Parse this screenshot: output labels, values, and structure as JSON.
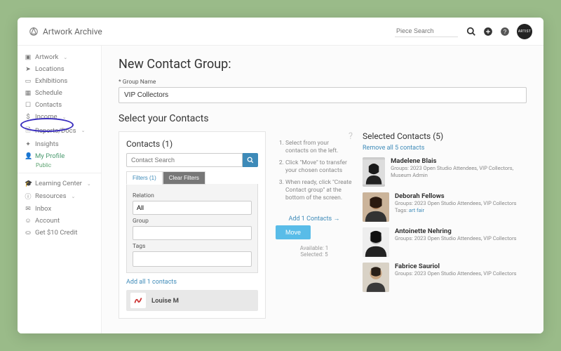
{
  "brand": "Artwork Archive",
  "topbar": {
    "search_placeholder": "Piece Search"
  },
  "sidebar": {
    "items": [
      {
        "label": "Artwork",
        "chev": true,
        "icon": "image"
      },
      {
        "label": "Locations",
        "icon": "location"
      },
      {
        "label": "Exhibitions",
        "icon": "frame"
      },
      {
        "label": "Schedule",
        "icon": "calendar"
      },
      {
        "label": "Contacts",
        "icon": "briefcase",
        "active": true
      },
      {
        "label": "Income",
        "chev": true,
        "icon": "money"
      },
      {
        "label": "Reports/Docs",
        "chev": true,
        "icon": "paper"
      },
      {
        "label": "Insights",
        "icon": "wand"
      },
      {
        "label": "My Profile",
        "icon": "person",
        "green": true,
        "sub": "Public"
      }
    ],
    "secondary": [
      {
        "label": "Learning Center",
        "chev": true,
        "icon": "grad"
      },
      {
        "label": "Resources",
        "chev": true,
        "icon": "info"
      },
      {
        "label": "Inbox",
        "icon": "mail"
      },
      {
        "label": "Account",
        "icon": "user"
      },
      {
        "label": "Get $10 Credit",
        "icon": "gift"
      }
    ]
  },
  "page": {
    "title": "New Contact Group:",
    "group_name_label": "* Group Name",
    "group_name_value": "VIP Collectors",
    "select_heading": "Select your Contacts"
  },
  "contacts_panel": {
    "title": "Contacts (1)",
    "search_placeholder": "Contact Search",
    "filter_tab": "Filters (1)",
    "clear_tab": "Clear Filters",
    "relation_label": "Relation",
    "relation_value": "All",
    "group_label": "Group",
    "group_value": "",
    "tags_label": "Tags",
    "tags_value": "",
    "add_all_link": "Add all 1 contacts",
    "row_name": "Louise M"
  },
  "middle": {
    "steps": [
      "Select from your contacts on the left.",
      "Click \"Move\" to transfer your chosen contacts",
      "When ready, click \"Create Contact group\" at the bottom of the screen."
    ],
    "add_link": "Add 1 Contacts",
    "move_label": "Move",
    "available_label": "Available: 1",
    "selected_label": "Selected: 5"
  },
  "selected": {
    "title": "Selected Contacts (5)",
    "remove_all": "Remove all 5 contacts",
    "items": [
      {
        "name": "Madelene Blais",
        "meta": "Groups: 2023 Open Studio Attendees, VIP Collectors, Museum Admin"
      },
      {
        "name": "Deborah Fellows",
        "meta": "Groups: 2023 Open Studio Attendees, VIP Collectors",
        "tags": "Tags: ",
        "taglink": "art fair"
      },
      {
        "name": "Antoinette Nehring",
        "meta": "Groups: 2023 Open Studio Attendees, VIP Collectors"
      },
      {
        "name": "Fabrice Sauriol",
        "meta": "Groups: 2023 Open Studio Attendees, VIP Collectors"
      }
    ]
  }
}
